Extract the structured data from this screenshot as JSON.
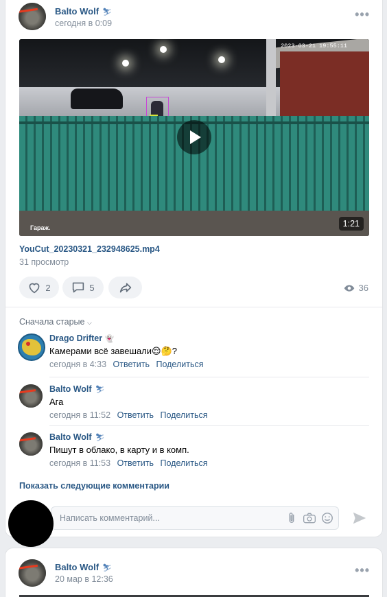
{
  "post": {
    "author": "Balto Wolf",
    "time": "сегодня в 0:09",
    "badge_icon": "skier-icon",
    "video": {
      "timestamp": "2023-03-21 19:55:11",
      "camera_label": "Гараж.",
      "duration": "1:21"
    },
    "file_name": "YouCut_20230321_232948625.mp4",
    "views_text": "31 просмотр",
    "likes": "2",
    "comments_count": "5",
    "views_count": "36"
  },
  "comments": {
    "sort_label": "Сначала старые",
    "items": [
      {
        "author": "Drago Drifter",
        "text": "Камерами всё завешали",
        "text_suffix": "?",
        "time": "сегодня в 4:33",
        "reply": "Ответить",
        "share": "Поделиться"
      },
      {
        "author": "Balto Wolf",
        "text": "Ага",
        "time": "сегодня в 11:52",
        "reply": "Ответить",
        "share": "Поделиться"
      },
      {
        "author": "Balto Wolf",
        "text": "Пишут в облако, в карту и в комп.",
        "time": "сегодня в 11:53",
        "reply": "Ответить",
        "share": "Поделиться"
      }
    ],
    "show_more": "Показать следующие комментарии",
    "input_placeholder": "Написать комментарий..."
  },
  "post2": {
    "author": "Balto Wolf",
    "time": "20 мар в 12:36"
  },
  "colors": {
    "accent": "#2a5885",
    "muted": "#818c99",
    "background": "#ebedf0"
  }
}
